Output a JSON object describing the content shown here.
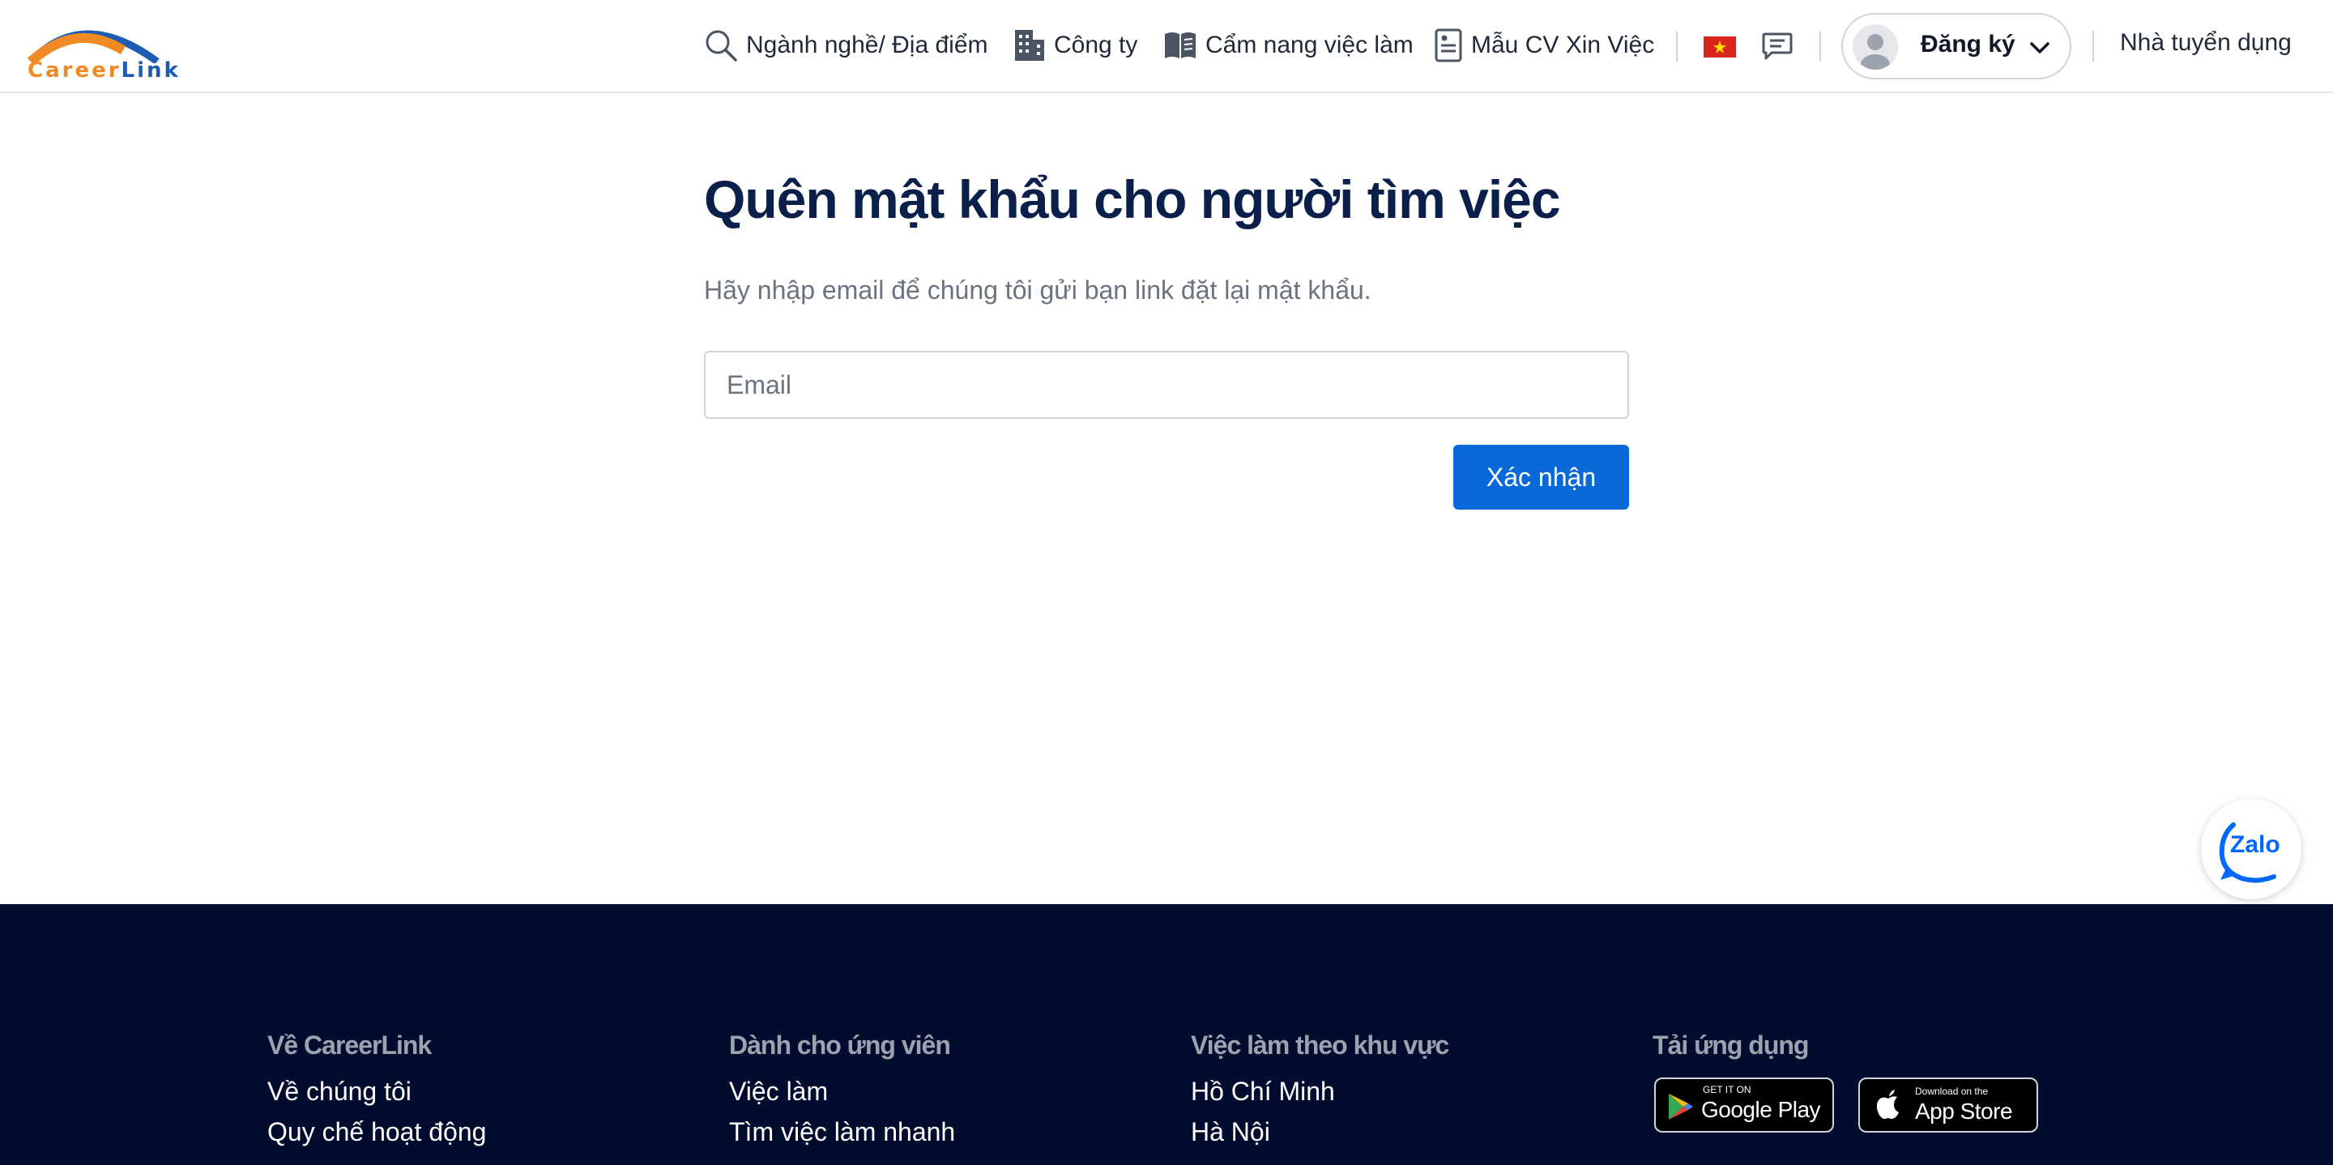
{
  "header": {
    "logo": {
      "part1": "Career",
      "part2": "Link"
    },
    "nav": [
      {
        "label": "Ngành nghề/ Địa điểm",
        "icon": "search-icon"
      },
      {
        "label": "Công ty",
        "icon": "building-icon"
      },
      {
        "label": "Cẩm nang việc làm",
        "icon": "book-icon"
      },
      {
        "label": "Mẫu CV Xin Việc",
        "icon": "document-icon"
      }
    ],
    "language_flag": "vietnam-flag-icon",
    "signup_label": "Đăng ký",
    "employer_label": "Nhà tuyển dụng"
  },
  "main": {
    "title": "Quên mật khẩu cho người tìm việc",
    "subtitle": "Hãy nhập email để chúng tôi gửi bạn link đặt lại mật khẩu.",
    "email_placeholder": "Email",
    "email_value": "",
    "submit_label": "Xác nhận"
  },
  "zalo": {
    "label": "Zalo"
  },
  "footer": {
    "columns": [
      {
        "heading": "Về CareerLink",
        "links": [
          "Về chúng tôi",
          "Quy chế hoạt động"
        ]
      },
      {
        "heading": "Dành cho ứng viên",
        "links": [
          "Việc làm",
          "Tìm việc làm nhanh"
        ]
      },
      {
        "heading": "Việc làm theo khu vực",
        "links": [
          "Hồ Chí Minh",
          "Hà Nội"
        ]
      },
      {
        "heading": "Tải ứng dụng",
        "links": []
      }
    ],
    "stores": [
      {
        "small": "GET IT ON",
        "big": "Google Play"
      },
      {
        "small": "Download on the",
        "big": "App Store"
      }
    ]
  },
  "colors": {
    "primary": "#0a69d9",
    "title": "#0b1f4b",
    "footer_bg": "#020c2e",
    "logo_orange": "#f08a24",
    "logo_blue": "#1d5db1"
  }
}
